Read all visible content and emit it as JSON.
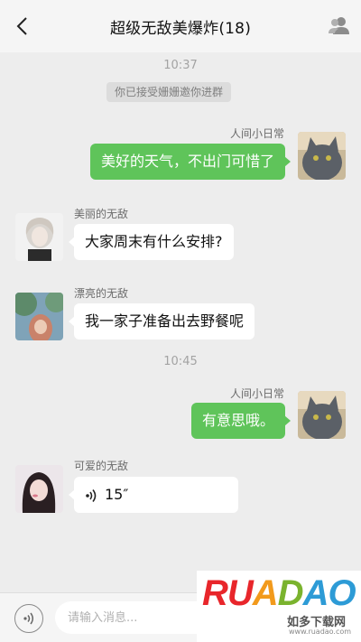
{
  "header": {
    "title": "超级无敌美爆炸(18)"
  },
  "messages": {
    "time1": "10:37",
    "system_notice": "你已接受姗姗邀你进群",
    "m1": {
      "sender": "人间小日常",
      "text": "美好的天气，不出门可惜了"
    },
    "m2": {
      "sender": "美丽的无敌",
      "text": "大家周末有什么安排?"
    },
    "m3": {
      "sender": "漂亮的无敌",
      "text": "我一家子准备出去野餐呢"
    },
    "time2": "10:45",
    "m4": {
      "sender": "人间小日常",
      "text": "有意思哦。"
    },
    "m5": {
      "sender": "可爱的无敌",
      "voice_duration": "15″"
    }
  },
  "input": {
    "placeholder": "请输入消息..."
  },
  "watermark": {
    "logo": "RUANDAO",
    "label": "如多下载网",
    "url": "www.ruadao.com"
  },
  "colors": {
    "bubble_right": "#5fc45a",
    "bubble_left": "#ffffff",
    "background": "#ededed"
  }
}
